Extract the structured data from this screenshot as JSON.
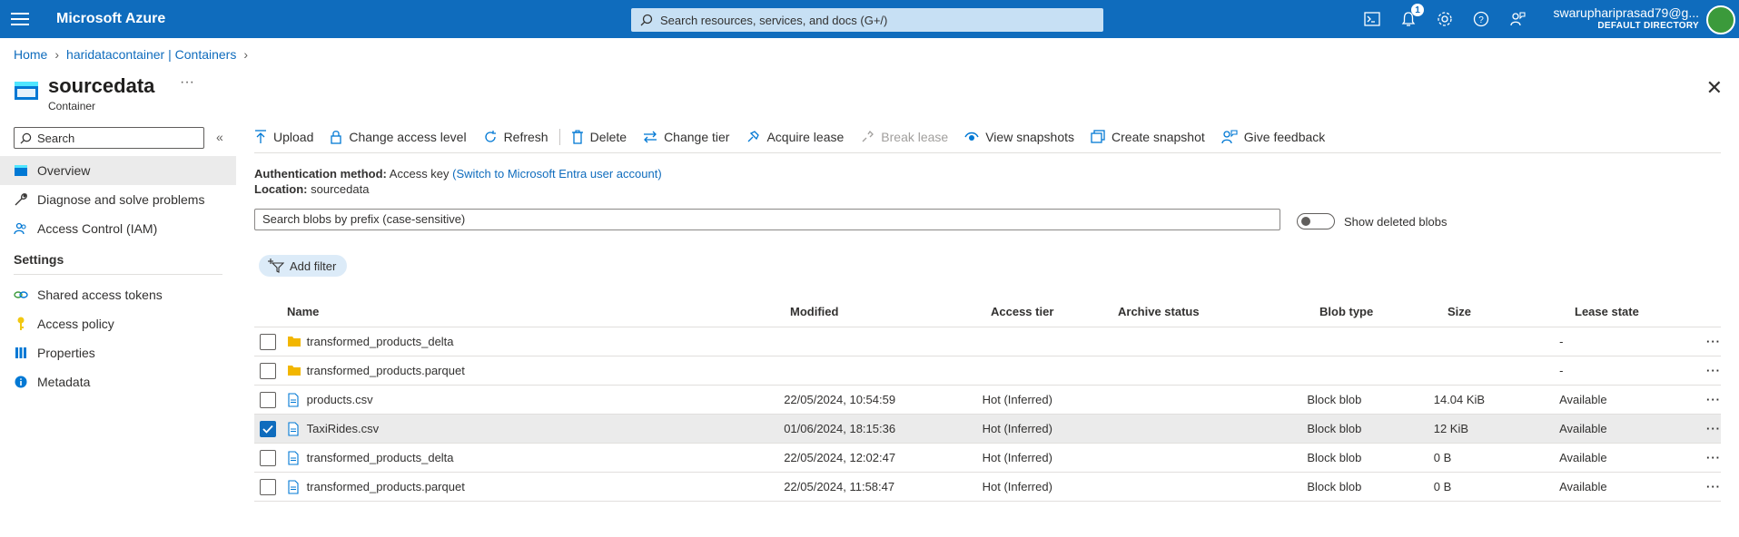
{
  "topbar": {
    "brand": "Microsoft Azure",
    "search_placeholder": "Search resources, services, and docs (G+/)",
    "notification_count": "1",
    "account_email": "swaruphariprasad79@g...",
    "account_directory": "DEFAULT DIRECTORY"
  },
  "breadcrumb": {
    "home": "Home",
    "container": "haridatacontainer | Containers"
  },
  "page": {
    "title": "sourcedata",
    "subtitle": "Container"
  },
  "sidebar": {
    "search_placeholder": "Search",
    "items": [
      {
        "label": "Overview",
        "icon": "overview-icon"
      },
      {
        "label": "Diagnose and solve problems",
        "icon": "wrench-icon"
      },
      {
        "label": "Access Control (IAM)",
        "icon": "people-icon"
      }
    ],
    "settings_header": "Settings",
    "settings_items": [
      {
        "label": "Shared access tokens",
        "icon": "link-icon"
      },
      {
        "label": "Access policy",
        "icon": "key-icon"
      },
      {
        "label": "Properties",
        "icon": "properties-icon"
      },
      {
        "label": "Metadata",
        "icon": "info-icon"
      }
    ]
  },
  "toolbar": {
    "upload": "Upload",
    "change_access_level": "Change access level",
    "refresh": "Refresh",
    "delete": "Delete",
    "change_tier": "Change tier",
    "acquire_lease": "Acquire lease",
    "break_lease": "Break lease",
    "view_snapshots": "View snapshots",
    "create_snapshot": "Create snapshot",
    "give_feedback": "Give feedback"
  },
  "auth": {
    "label": "Authentication method:",
    "value": "Access key",
    "link": "(Switch to Microsoft Entra user account)",
    "location_label": "Location:",
    "location_value": "sourcedata"
  },
  "blob_search_placeholder": "Search blobs by prefix (case-sensitive)",
  "show_deleted_label": "Show deleted blobs",
  "add_filter": "Add filter",
  "table": {
    "headers": {
      "name": "Name",
      "modified": "Modified",
      "tier": "Access tier",
      "archive": "Archive status",
      "type": "Blob type",
      "size": "Size",
      "lease": "Lease state"
    },
    "rows": [
      {
        "name": "transformed_products_delta",
        "kind": "folder",
        "modified": "",
        "tier": "",
        "archive": "",
        "type": "",
        "size": "",
        "lease": "-",
        "checked": false
      },
      {
        "name": "transformed_products.parquet",
        "kind": "folder",
        "modified": "",
        "tier": "",
        "archive": "",
        "type": "",
        "size": "",
        "lease": "-",
        "checked": false
      },
      {
        "name": "products.csv",
        "kind": "file",
        "modified": "22/05/2024, 10:54:59",
        "tier": "Hot (Inferred)",
        "archive": "",
        "type": "Block blob",
        "size": "14.04 KiB",
        "lease": "Available",
        "checked": false
      },
      {
        "name": "TaxiRides.csv",
        "kind": "file",
        "modified": "01/06/2024, 18:15:36",
        "tier": "Hot (Inferred)",
        "archive": "",
        "type": "Block blob",
        "size": "12 KiB",
        "lease": "Available",
        "checked": true
      },
      {
        "name": "transformed_products_delta",
        "kind": "file",
        "modified": "22/05/2024, 12:02:47",
        "tier": "Hot (Inferred)",
        "archive": "",
        "type": "Block blob",
        "size": "0 B",
        "lease": "Available",
        "checked": false
      },
      {
        "name": "transformed_products.parquet",
        "kind": "file",
        "modified": "22/05/2024, 11:58:47",
        "tier": "Hot (Inferred)",
        "archive": "",
        "type": "Block blob",
        "size": "0 B",
        "lease": "Available",
        "checked": false
      }
    ]
  }
}
